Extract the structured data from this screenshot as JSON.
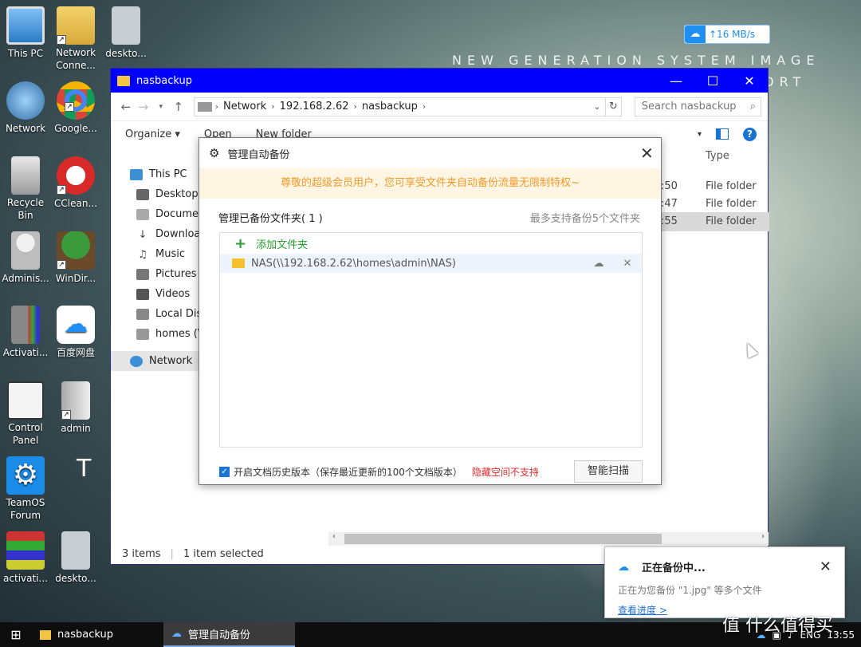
{
  "wallpaper": {
    "line1": "NEW GENERATION SYSTEM IMAGE",
    "line2": "ORT",
    "big": "T C"
  },
  "speed_widget": {
    "rate": "↑16 MB/s"
  },
  "desktop_icons": [
    {
      "label": "This PC"
    },
    {
      "label": "Network Conne..."
    },
    {
      "label": "deskto..."
    },
    {
      "label": "Network"
    },
    {
      "label": "Google..."
    },
    {
      "label": "Recycle Bin"
    },
    {
      "label": "CClean..."
    },
    {
      "label": "Adminis..."
    },
    {
      "label": "WinDir..."
    },
    {
      "label": "Activati..."
    },
    {
      "label": "百度网盘"
    },
    {
      "label": "Control Panel"
    },
    {
      "label": "admin"
    },
    {
      "label": "TeamOS Forum"
    },
    {
      "label": "activati..."
    },
    {
      "label": "deskto..."
    }
  ],
  "explorer": {
    "title": "nasbackup",
    "address": [
      "Network",
      "192.168.2.62",
      "nasbackup"
    ],
    "search_placeholder": "Search nasbackup",
    "commands": {
      "organize": "Organize ▾",
      "open": "Open",
      "new_folder": "New folder"
    },
    "nav": [
      {
        "label": "This PC"
      },
      {
        "label": "Desktop"
      },
      {
        "label": "Documen"
      },
      {
        "label": "Downloa"
      },
      {
        "label": "Music"
      },
      {
        "label": "Pictures"
      },
      {
        "label": "Videos"
      },
      {
        "label": "Local Dis"
      },
      {
        "label": "homes (\\"
      },
      {
        "label": "Network"
      }
    ],
    "columns": {
      "type": "Type"
    },
    "rows": [
      {
        "modified": ":50",
        "type": "File folder"
      },
      {
        "modified": ":47",
        "type": "File folder"
      },
      {
        "modified": ":55",
        "type": "File folder"
      }
    ],
    "status": {
      "items": "3 items",
      "selected": "1 item selected"
    }
  },
  "dialog": {
    "title": "管理自动备份",
    "notice": "尊敬的超级会员用户，您可享受文件夹自动备份流量无限制特权~",
    "list_title": "管理已备份文件夹( 1 )",
    "limit_text": "最多支持备份5个文件夹",
    "add_folder": "添加文件夹",
    "folder_name": "NAS(\\\\192.168.2.62\\homes\\admin\\NAS)",
    "history_checkbox": "开启文档历史版本（保存最近更新的100个文档版本）",
    "hidden_warning": "隐藏空间不支持",
    "scan_button": "智能扫描"
  },
  "notification": {
    "title": "正在备份中...",
    "text": "正在为您备份 \"1.jpg\" 等多个文件",
    "link": "查看进度 >"
  },
  "taskbar": {
    "items": [
      {
        "label": "nasbackup"
      },
      {
        "label": "管理自动备份"
      }
    ],
    "lang": "ENG",
    "time": "13:55"
  },
  "watermark": "值 什么值得买"
}
